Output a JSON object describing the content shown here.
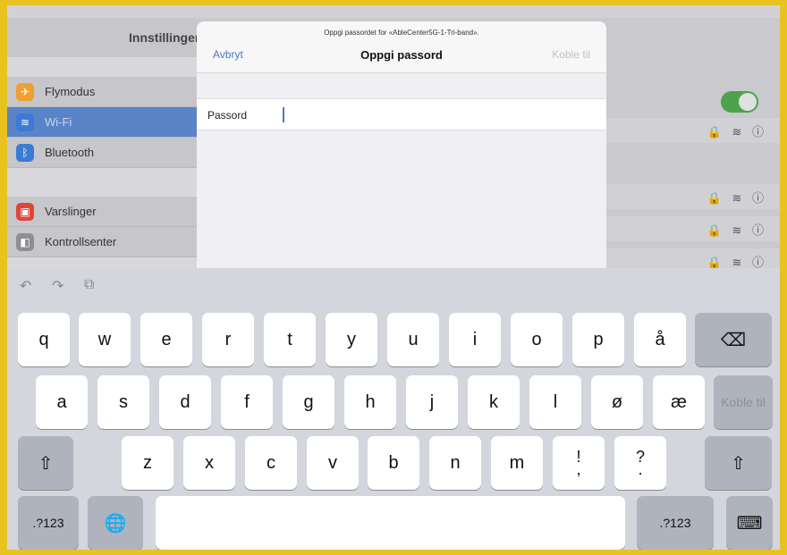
{
  "sidebar": {
    "title": "Innstillinger",
    "items": [
      {
        "label": "Flymodus",
        "icon": "airplane-icon",
        "color": "#f0a030"
      },
      {
        "label": "Wi-Fi",
        "icon": "wifi-icon",
        "color": "#3a7bd5"
      },
      {
        "label": "Bluetooth",
        "icon": "bluetooth-icon",
        "color": "#3a7bd5"
      },
      {
        "label": "Varslinger",
        "icon": "notifications-icon",
        "color": "#e0453a"
      },
      {
        "label": "Kontrollsenter",
        "icon": "control-center-icon",
        "color": "#8e8e93"
      }
    ]
  },
  "sheet": {
    "prompt": "Oppgi passordet for «AbleCenter5G-1-Tri-band».",
    "title": "Oppgi passord",
    "cancel": "Avbryt",
    "join": "Koble til",
    "password_label": "Passord",
    "password_value": ""
  },
  "keyboard": {
    "row1": [
      "q",
      "w",
      "e",
      "r",
      "t",
      "y",
      "u",
      "i",
      "o",
      "p",
      "å"
    ],
    "row2": [
      "a",
      "s",
      "d",
      "f",
      "g",
      "h",
      "j",
      "k",
      "l",
      "ø",
      "æ"
    ],
    "row3": [
      "z",
      "x",
      "c",
      "v",
      "b",
      "n",
      "m"
    ],
    "row3_punct": [
      [
        "!",
        ","
      ],
      [
        "?",
        "."
      ]
    ],
    "join_key": "Koble til",
    "num_key": ".?123"
  },
  "colors": {
    "accent": "#4a78c4",
    "toggle_on": "#4da24d",
    "frame_border": "#e8c320"
  }
}
